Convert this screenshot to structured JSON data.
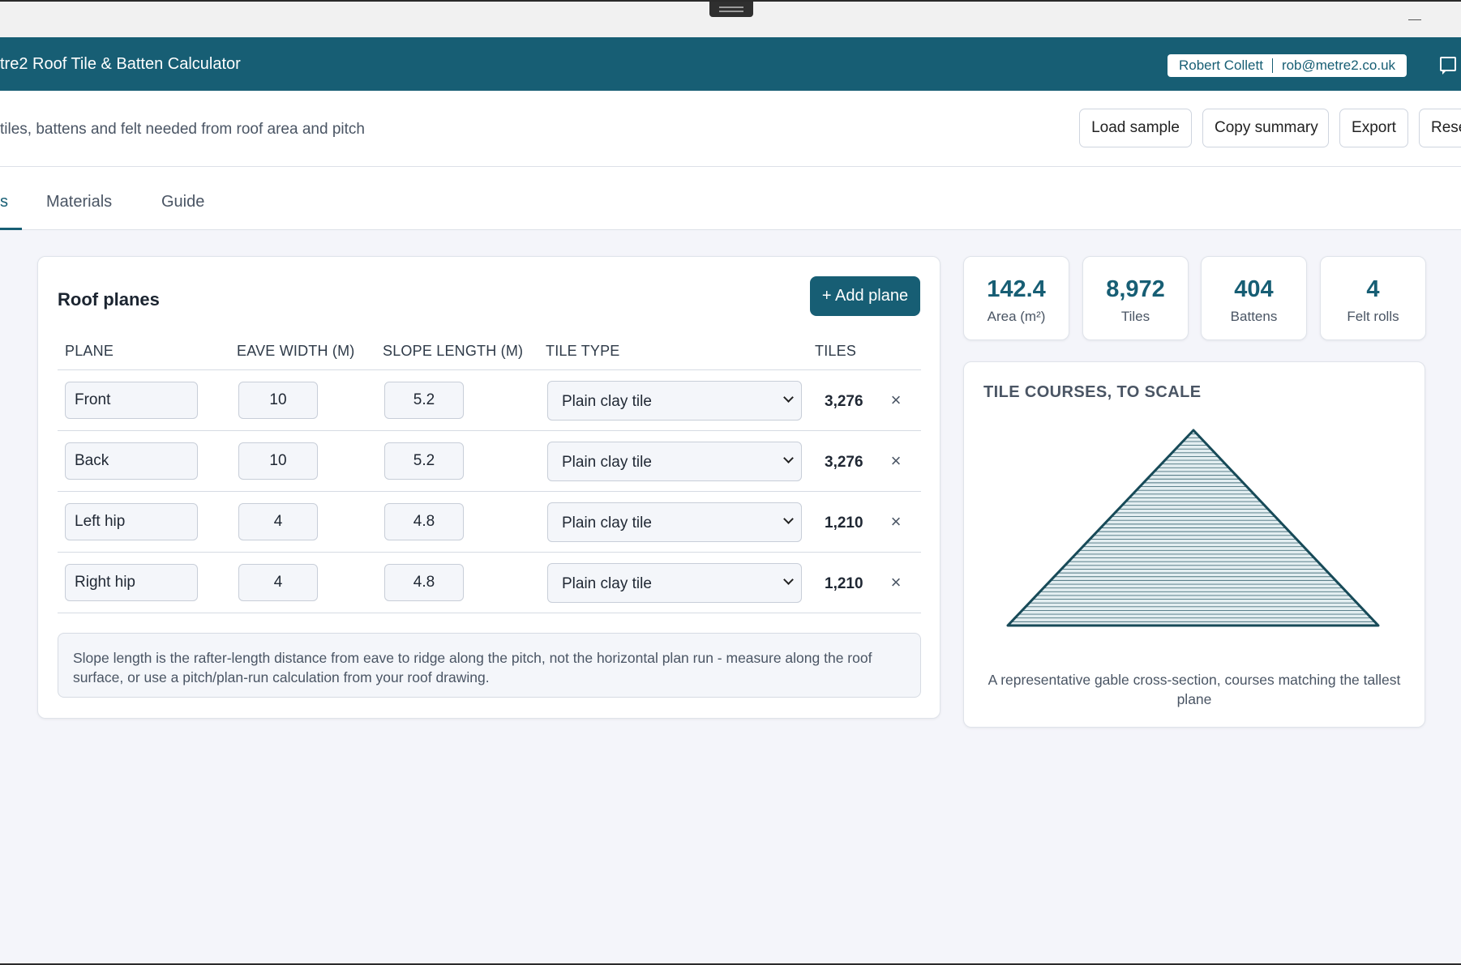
{
  "app": {
    "title": "tre2 Roof Tile & Batten Calculator",
    "user_name": "Robert Collett",
    "user_email": "rob@metre2.co.uk"
  },
  "subheader": {
    "subtitle": "tiles, battens and felt needed from roof area and pitch",
    "buttons": [
      "Load sample",
      "Copy summary",
      "Export",
      "Rese"
    ]
  },
  "tabs": [
    {
      "label": "s",
      "active": true
    },
    {
      "label": "Materials",
      "active": false
    },
    {
      "label": "Guide",
      "active": false
    }
  ],
  "planes": {
    "title": "Roof planes",
    "add_label": "+ Add plane",
    "columns": [
      "PLANE",
      "EAVE WIDTH (M)",
      "SLOPE LENGTH (M)",
      "TILE TYPE",
      "TILES"
    ],
    "rows": [
      {
        "name": "Front",
        "eave_width": "10",
        "slope_length": "5.2",
        "tile_type": "Plain clay tile",
        "tiles": "3,276"
      },
      {
        "name": "Back",
        "eave_width": "10",
        "slope_length": "5.2",
        "tile_type": "Plain clay tile",
        "tiles": "3,276"
      },
      {
        "name": "Left hip",
        "eave_width": "4",
        "slope_length": "4.8",
        "tile_type": "Plain clay tile",
        "tiles": "1,210"
      },
      {
        "name": "Right hip",
        "eave_width": "4",
        "slope_length": "4.8",
        "tile_type": "Plain clay tile",
        "tiles": "1,210"
      }
    ],
    "delete_glyph": "×",
    "note": "Slope length is the rafter-length distance from eave to ridge along the pitch, not the horizontal plan run - measure along the roof surface, or use a pitch/plan-run calculation from your roof drawing."
  },
  "stats": [
    {
      "value": "142.4",
      "label": "Area (m²)"
    },
    {
      "value": "8,972",
      "label": "Tiles"
    },
    {
      "value": "404",
      "label": "Battens"
    },
    {
      "value": "4",
      "label": "Felt rolls"
    }
  ],
  "scale": {
    "title": "TILE COURSES, TO SCALE",
    "caption": "A representative gable cross-section, courses matching the tallest plane",
    "courses": 52
  },
  "colors": {
    "brand": "#175e74",
    "gable_stroke": "#174a58",
    "gable_fill": "#e3eef1"
  },
  "icons": {
    "chat": "chat-bubble-icon",
    "chevron": "chevron-down-icon",
    "delete": "close-icon"
  }
}
